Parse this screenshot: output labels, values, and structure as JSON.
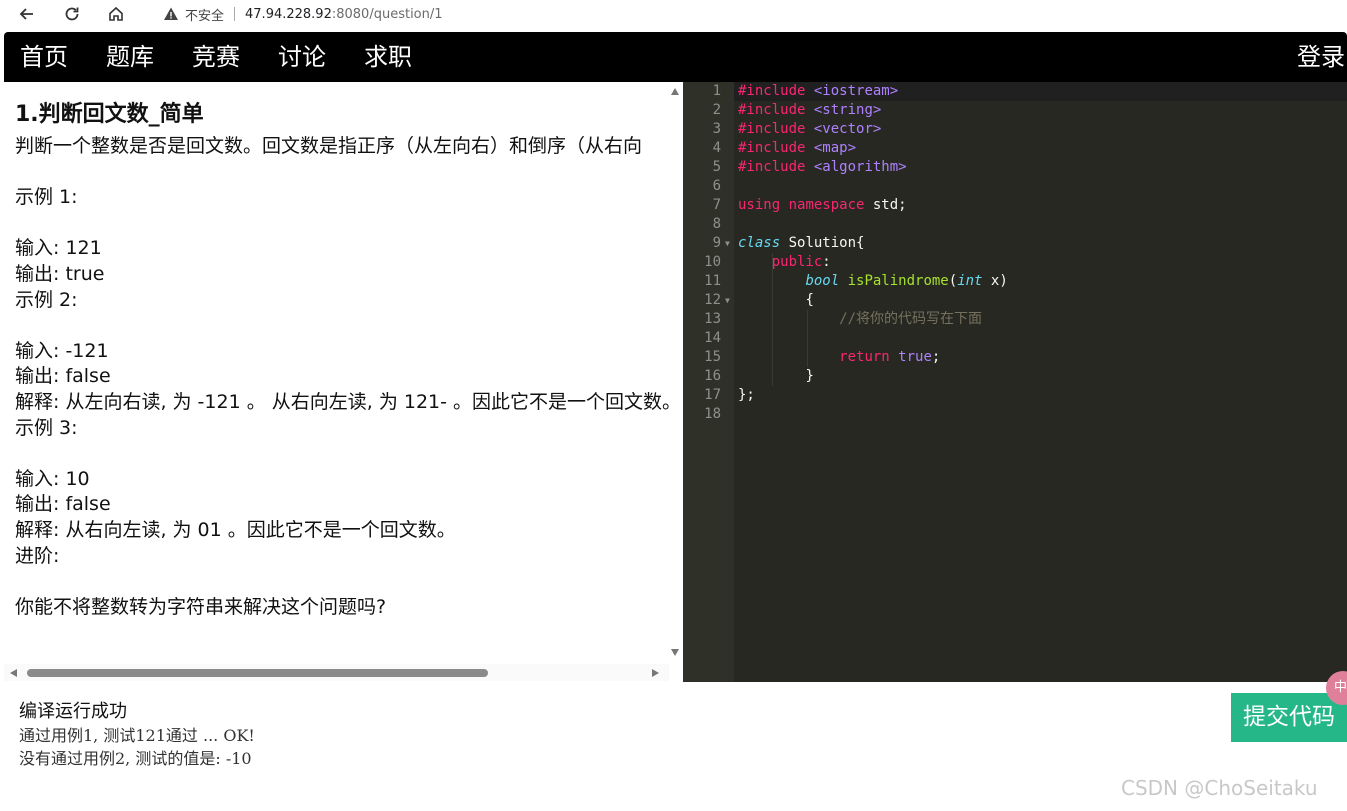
{
  "browser": {
    "security_label": "不安全",
    "url_host": "47.94.228.92",
    "url_path": ":8080/question/1"
  },
  "nav": {
    "items": [
      "首页",
      "题库",
      "竞赛",
      "讨论",
      "求职"
    ],
    "login": "登录"
  },
  "question": {
    "title": "1.判断回文数_简单",
    "description": "判断一个整数是否是回文数。回文数是指正序（从左向右）和倒序（从右向\n\n示例 1:\n\n输入: 121\n输出: true\n示例 2:\n\n输入: -121\n输出: false\n解释: 从左向右读, 为 -121 。 从右向左读, 为 121- 。因此它不是一个回文数。\n示例 3:\n\n输入: 10\n输出: false\n解释: 从右向左读, 为 01 。因此它不是一个回文数。\n进阶:\n\n你能不将整数转为字符串来解决这个问题吗?"
  },
  "editor": {
    "line_numbers": [
      "1",
      "2",
      "3",
      "4",
      "5",
      "6",
      "7",
      "8",
      "9",
      "10",
      "11",
      "12",
      "13",
      "14",
      "15",
      "16",
      "17",
      "18"
    ],
    "tokens": {
      "include": "#include",
      "lib1": "<iostream>",
      "lib2": "<string>",
      "lib3": "<vector>",
      "lib4": "<map>",
      "lib5": "<algorithm>",
      "using": "using",
      "namespace": "namespace",
      "std": " std;",
      "class_kw": "class",
      "class_name": " Solution{",
      "public": "public",
      "colon": ":",
      "bool_kw": "bool",
      "fn_name": "isPalindrome",
      "paren_open": "(",
      "int_kw": "int",
      "param": " x)",
      "brace_open": "{",
      "comment": "//将你的代码写在下面",
      "return_kw": "return",
      "true_kw": "true",
      "semicolon": ";",
      "brace_close": "}",
      "class_end": "};"
    }
  },
  "result": {
    "status": "编译运行成功",
    "lines": [
      "通过用例1, 测试121通过 ... OK!",
      "没有通过用例2, 测试的值是: -10"
    ]
  },
  "submit_label": "提交代码",
  "float_button": "中",
  "watermark": "CSDN @ChoSeitaku"
}
